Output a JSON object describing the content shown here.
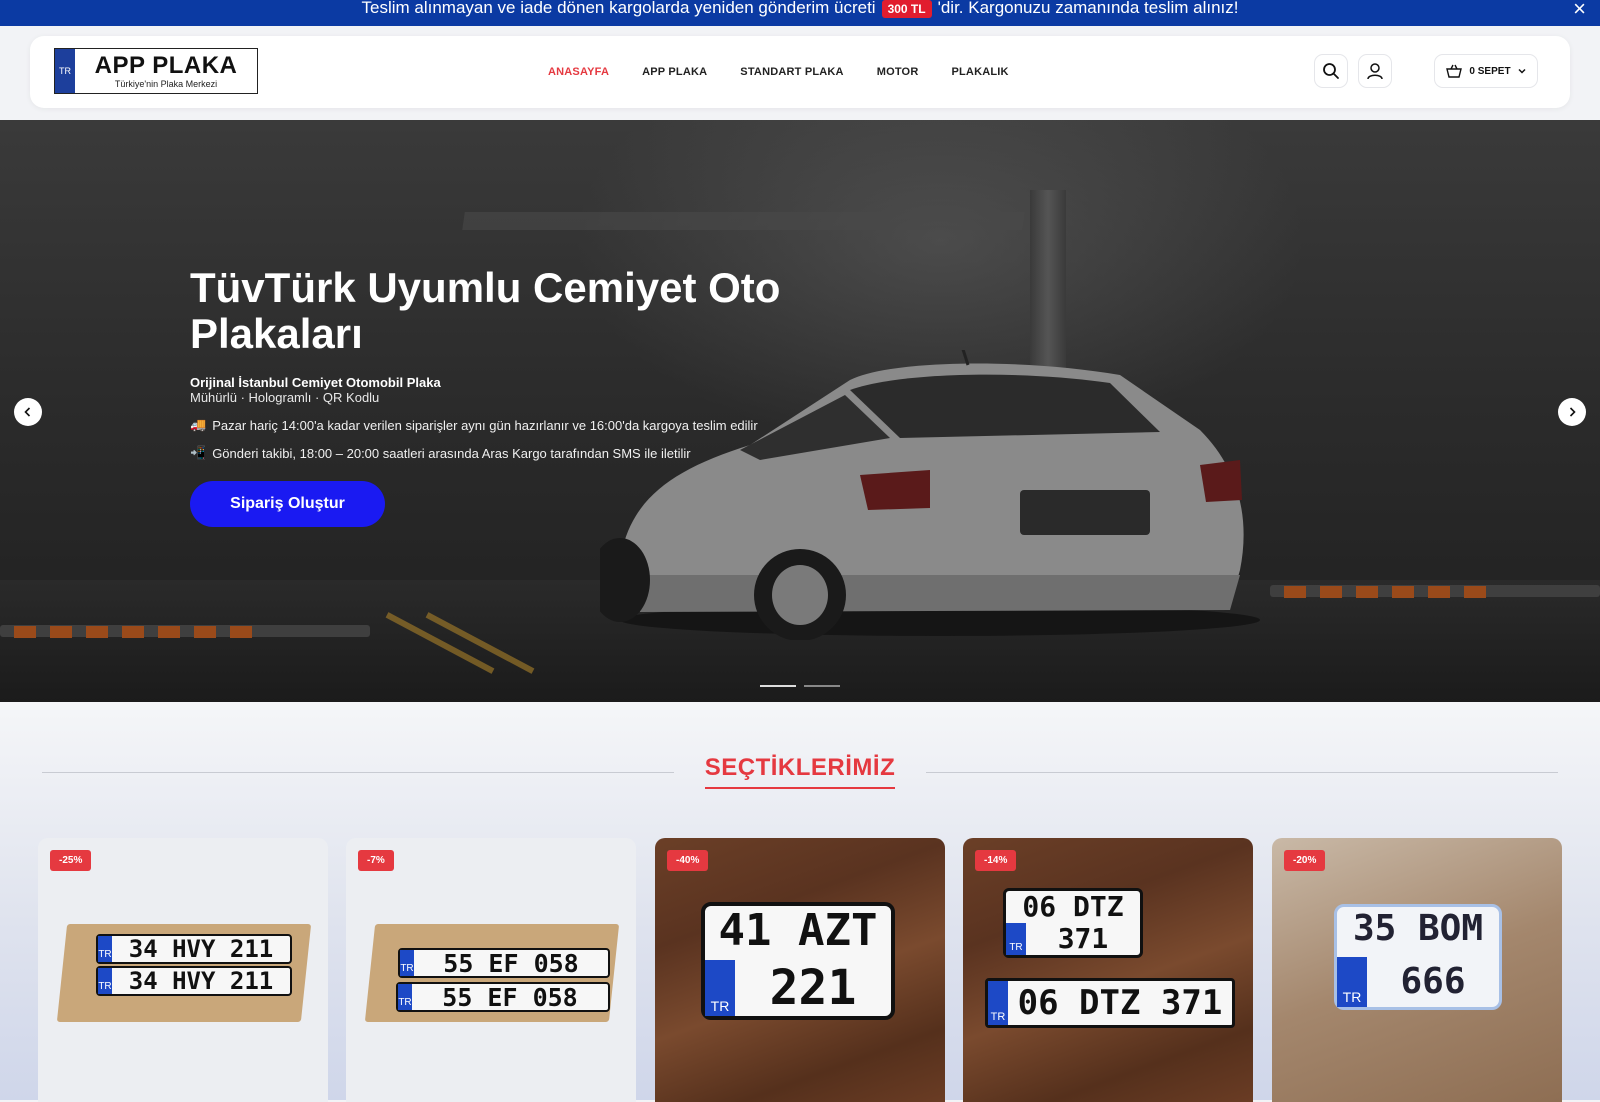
{
  "announcement": {
    "text_before": "Teslim alınmayan ve iade dönen kargolarda yeniden gönderim ücreti",
    "badge": "300 TL",
    "text_after": "'dir. Kargonuzu zamanında teslim alınız!",
    "close_label": "×"
  },
  "logo": {
    "badge": "TR",
    "title": "APP PLAKA",
    "subtitle": "Türkiye'nin Plaka Merkezi"
  },
  "nav": {
    "items": [
      {
        "label": "ANASAYFA",
        "active": true
      },
      {
        "label": "APP PLAKA",
        "active": false
      },
      {
        "label": "STANDART PLAKA",
        "active": false
      },
      {
        "label": "MOTOR",
        "active": false
      },
      {
        "label": "PLAKALIK",
        "active": false
      }
    ]
  },
  "header_actions": {
    "search_icon": "search-icon",
    "account_icon": "user-icon",
    "cart_label": "0 SEPET"
  },
  "hero": {
    "title": "TüvTürk Uyumlu Cemiyet Oto Plakaları",
    "subtitle": "Orijinal İstanbul Cemiyet Otomobil Plaka",
    "subtitle2": "Mühürlü · Hologramlı · QR Kodlu",
    "line1_icon": "🚚",
    "line1": "Pazar hariç 14:00'a kadar verilen siparişler aynı gün hazırlanır ve 16:00'da kargoya teslim edilir",
    "line2_icon": "📲",
    "line2": "Gönderi takibi, 18:00 – 20:00 saatleri arasında Aras Kargo tarafından SMS ile iletilir",
    "button": "Sipariş Oluştur",
    "prev_icon": "chevron-left-icon",
    "next_icon": "chevron-right-icon",
    "active_slide": 1,
    "slide_count": 2
  },
  "picks": {
    "heading": "SEÇTİKLERİMİZ",
    "products": [
      {
        "discount": "-25%",
        "plate_top": "34 HVY 211",
        "plate_bottom": "34 HVY 211",
        "style": "box"
      },
      {
        "discount": "-7%",
        "plate_top": "55 EF 058",
        "plate_bottom": "55 EF 058",
        "style": "box"
      },
      {
        "discount": "-40%",
        "plate_line1": "41 AZT",
        "plate_line2": "221",
        "style": "square"
      },
      {
        "discount": "-14%",
        "plate_line1": "06 DTZ",
        "plate_line2": "371",
        "plate_long": "06 DTZ 371",
        "style": "combo"
      },
      {
        "discount": "-20%",
        "plate_line1": "35 BOM",
        "plate_line2": "666",
        "style": "square-small"
      }
    ]
  },
  "plate_country": "TR"
}
